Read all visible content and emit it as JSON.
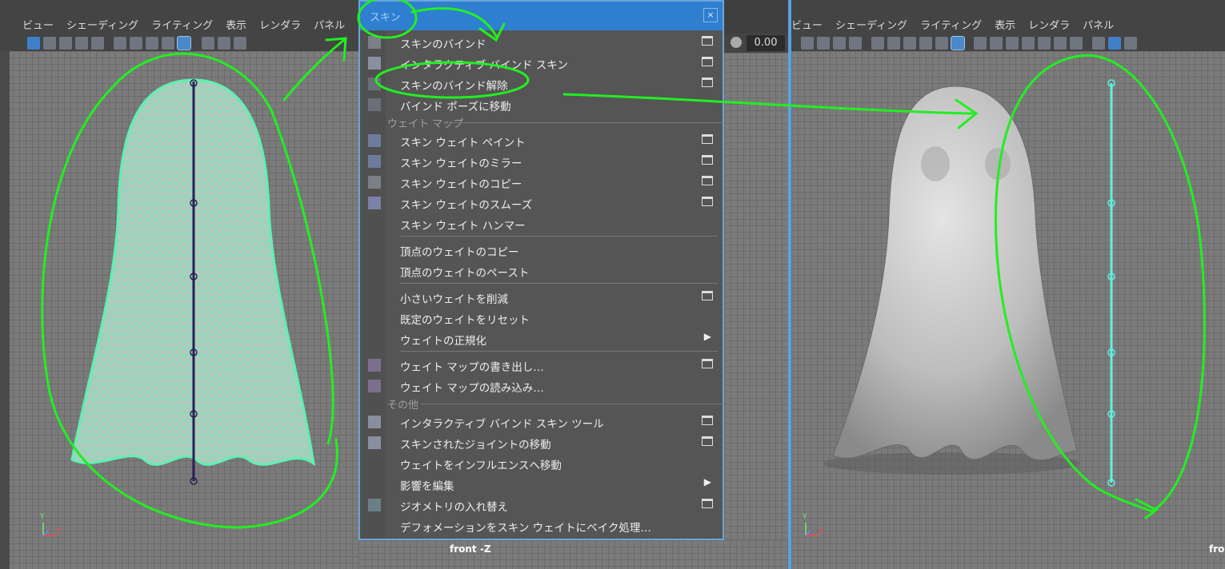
{
  "left_viewport": {
    "menu": [
      "ビュー",
      "シェーディング",
      "ライティング",
      "表示",
      "レンダラ",
      "パネル"
    ],
    "axis_y": "Y",
    "axis_x": "X"
  },
  "right_viewport": {
    "menu": [
      "ビュー",
      "シェーディング",
      "ライティング",
      "表示",
      "レンダラ",
      "パネル"
    ],
    "axis_y": "Y",
    "axis_x": "X",
    "camera_label": "fro"
  },
  "center": {
    "field_value": "0.00",
    "camera_label": "front -Z"
  },
  "skin_menu": {
    "title": "スキン",
    "close": "×",
    "items": [
      {
        "label": "スキンのバインド",
        "option_box": true
      },
      {
        "label": "インタラクティブ バインド スキン",
        "option_box": true
      },
      {
        "label": "スキンのバインド解除",
        "option_box": true
      },
      {
        "label": "バインド ポーズに移動",
        "option_box": false
      }
    ],
    "section_weight_maps": "ウェイト マップ",
    "weight_items": [
      {
        "label": "スキン ウェイト ペイント",
        "option_box": true
      },
      {
        "label": "スキン ウェイトのミラー",
        "option_box": true
      },
      {
        "label": "スキン ウェイトのコピー",
        "option_box": true
      },
      {
        "label": "スキン ウェイトのスムーズ",
        "option_box": true
      },
      {
        "label": "スキン ウェイト ハンマー",
        "option_box": false
      }
    ],
    "vertex_items": [
      {
        "label": "頂点のウェイトのコピー"
      },
      {
        "label": "頂点のウェイトのペースト"
      }
    ],
    "weight_ops": [
      {
        "label": "小さいウェイトを削減",
        "option_box": true
      },
      {
        "label": "既定のウェイトをリセット",
        "option_box": false
      },
      {
        "label": "ウェイトの正規化",
        "submenu": true
      }
    ],
    "map_io": [
      {
        "label": "ウェイト マップの書き出し…",
        "option_box": true
      },
      {
        "label": "ウェイト マップの読み込み…",
        "option_box": false
      }
    ],
    "section_other": "その他",
    "other_items": [
      {
        "label": "インタラクティブ バインド スキン ツール",
        "option_box": true
      },
      {
        "label": "スキンされたジョイントの移動",
        "option_box": true
      },
      {
        "label": "ウェイトをインフルエンスへ移動",
        "option_box": false
      },
      {
        "label": "影響を編集",
        "submenu": true
      },
      {
        "label": "ジオメトリの入れ替え",
        "option_box": true
      },
      {
        "label": "デフォメーションをスキン ウェイトにベイク処理…",
        "option_box": false
      }
    ]
  },
  "colors": {
    "annotation": "#22ee22",
    "wireframe": "#5ff0b0",
    "title_bar": "#2f7fd0"
  }
}
